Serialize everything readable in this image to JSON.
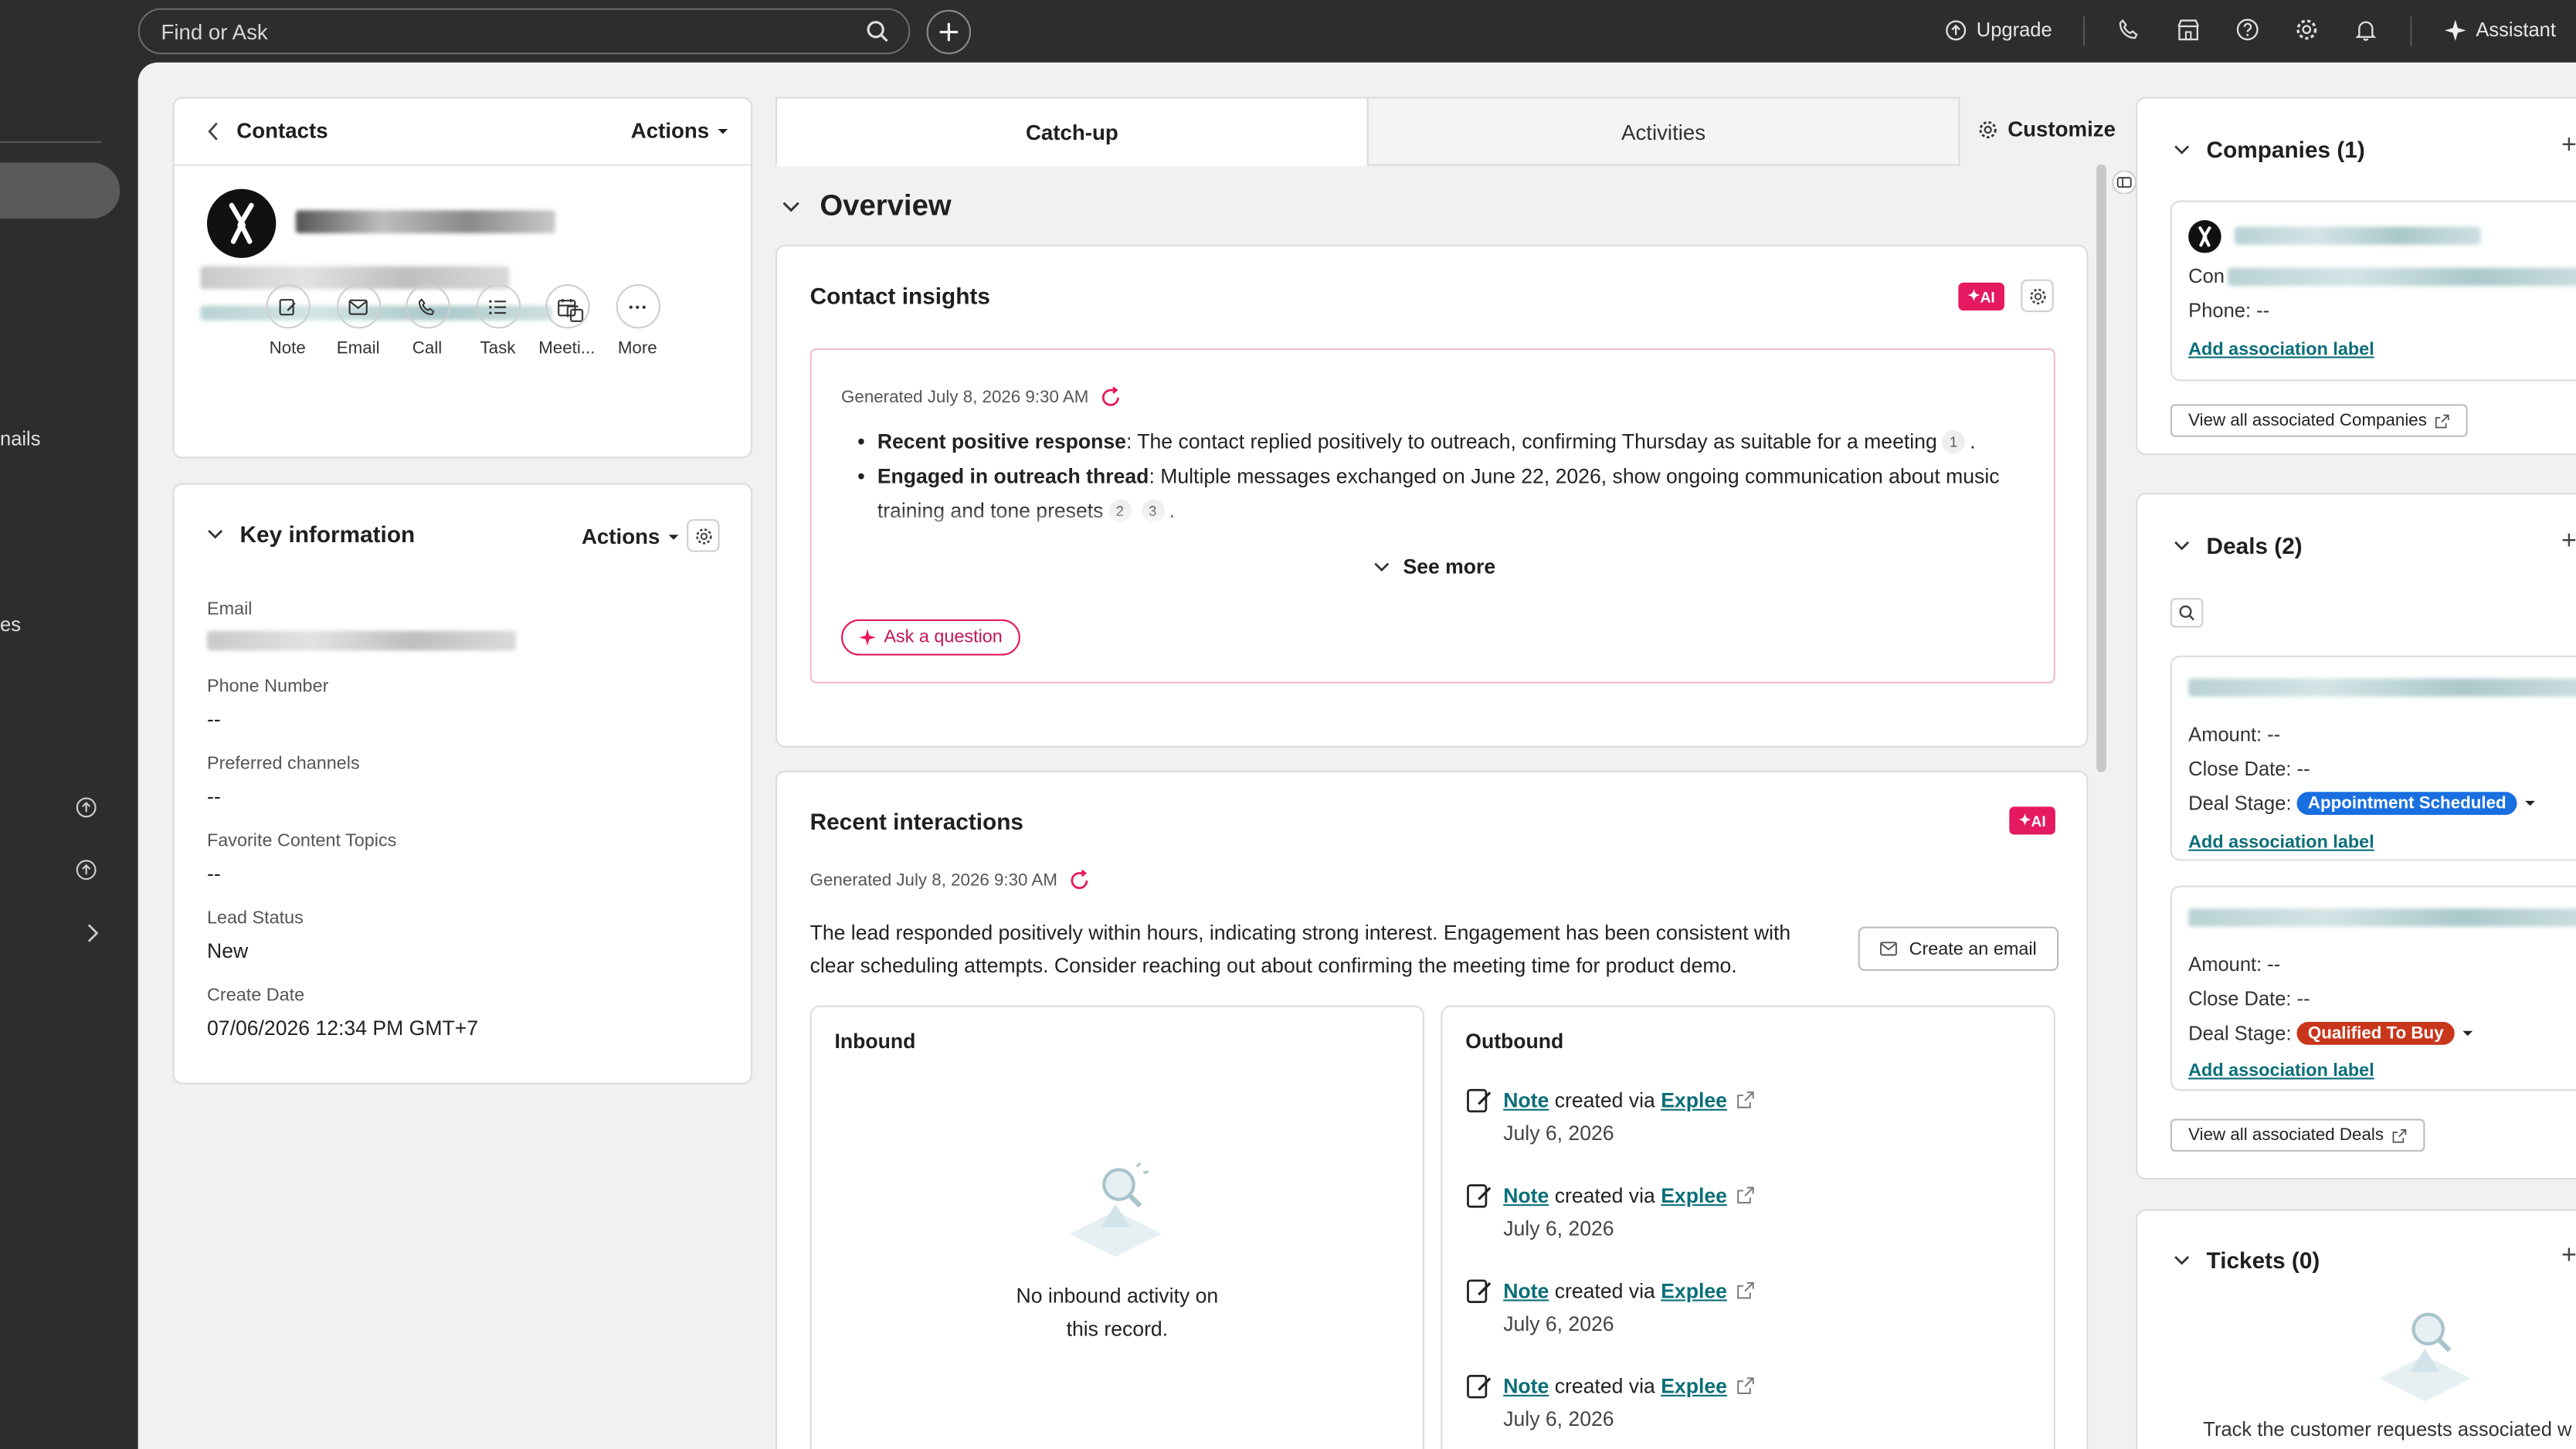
{
  "topbar": {
    "search_placeholder": "Find or Ask",
    "upgrade": "Upgrade",
    "assistant": "Assistant"
  },
  "leftnav": {
    "partial_1": "nails",
    "partial_2": "es"
  },
  "contact": {
    "back_label": "Contacts",
    "actions_label": "Actions",
    "quick_actions": [
      "Note",
      "Email",
      "Call",
      "Task",
      "Meeti...",
      "More"
    ]
  },
  "key_info": {
    "title": "Key information",
    "actions_label": "Actions",
    "fields": [
      {
        "label": "Email",
        "value": ""
      },
      {
        "label": "Phone Number",
        "value": "--"
      },
      {
        "label": "Preferred channels",
        "value": "--"
      },
      {
        "label": "Favorite Content Topics",
        "value": "--"
      },
      {
        "label": "Lead Status",
        "value": "New"
      },
      {
        "label": "Create Date",
        "value": "07/06/2026 12:34 PM GMT+7"
      }
    ]
  },
  "tabs": {
    "catchup": "Catch-up",
    "activities": "Activities",
    "customize": "Customize"
  },
  "overview": {
    "title": "Overview"
  },
  "insights": {
    "title": "Contact insights",
    "ai_badge": "AI",
    "generated": "Generated July 8, 2026 9:30 AM",
    "b1_bold": "Recent positive response",
    "b1_text": ": The contact replied positively to outreach, confirming Thursday as suitable for a meeting",
    "b1_cite": "1",
    "b2_bold": "Engaged in outreach thread",
    "b2_text": ": Multiple messages exchanged on June 22, 2026, show ongoing communication about music training and tone presets",
    "b2_cite_a": "2",
    "b2_cite_b": "3",
    "see_more": "See more",
    "ask": "Ask a question"
  },
  "recent": {
    "title": "Recent interactions",
    "ai_badge": "AI",
    "generated": "Generated July 8, 2026 9:30 AM",
    "summary": "The lead responded positively within hours, indicating strong interest. Engagement has been consistent with clear scheduling attempts. Consider reaching out about confirming the meeting time for product demo.",
    "create_email": "Create an email",
    "inbound_title": "Inbound",
    "inbound_empty_1": "No inbound activity on",
    "inbound_empty_2": "this record.",
    "outbound_title": "Outbound",
    "outbound_items": [
      {
        "type": "Note",
        "via": "created via",
        "app": "Explee",
        "date": "July 6, 2026"
      },
      {
        "type": "Note",
        "via": "created via",
        "app": "Explee",
        "date": "July 6, 2026"
      },
      {
        "type": "Note",
        "via": "created via",
        "app": "Explee",
        "date": "July 6, 2026"
      },
      {
        "type": "Note",
        "via": "created via",
        "app": "Explee",
        "date": "July 6, 2026"
      }
    ]
  },
  "companies": {
    "title": "Companies (1)",
    "con_prefix": "Con",
    "phone": "Phone: --",
    "add_label": "Add association label",
    "view_all": "View all associated Companies"
  },
  "deals": {
    "title": "Deals (2)",
    "items": [
      {
        "amount": "Amount: --",
        "close": "Close Date: --",
        "stage_label": "Deal Stage:",
        "stage": "Appointment Scheduled",
        "stage_color": "#1a6fe0",
        "add_label": "Add association label"
      },
      {
        "amount": "Amount: --",
        "close": "Close Date: --",
        "stage_label": "Deal Stage:",
        "stage": "Qualified To Buy",
        "stage_color": "#c8361c",
        "add_label": "Add association label"
      }
    ],
    "view_all": "View all associated Deals"
  },
  "tickets": {
    "title": "Tickets (0)",
    "empty": "Track the customer requests associated w"
  },
  "colors": {
    "accent_teal": "#0b6e78",
    "ai_pink": "#e5195f",
    "topbar": "#2d2d2d"
  }
}
